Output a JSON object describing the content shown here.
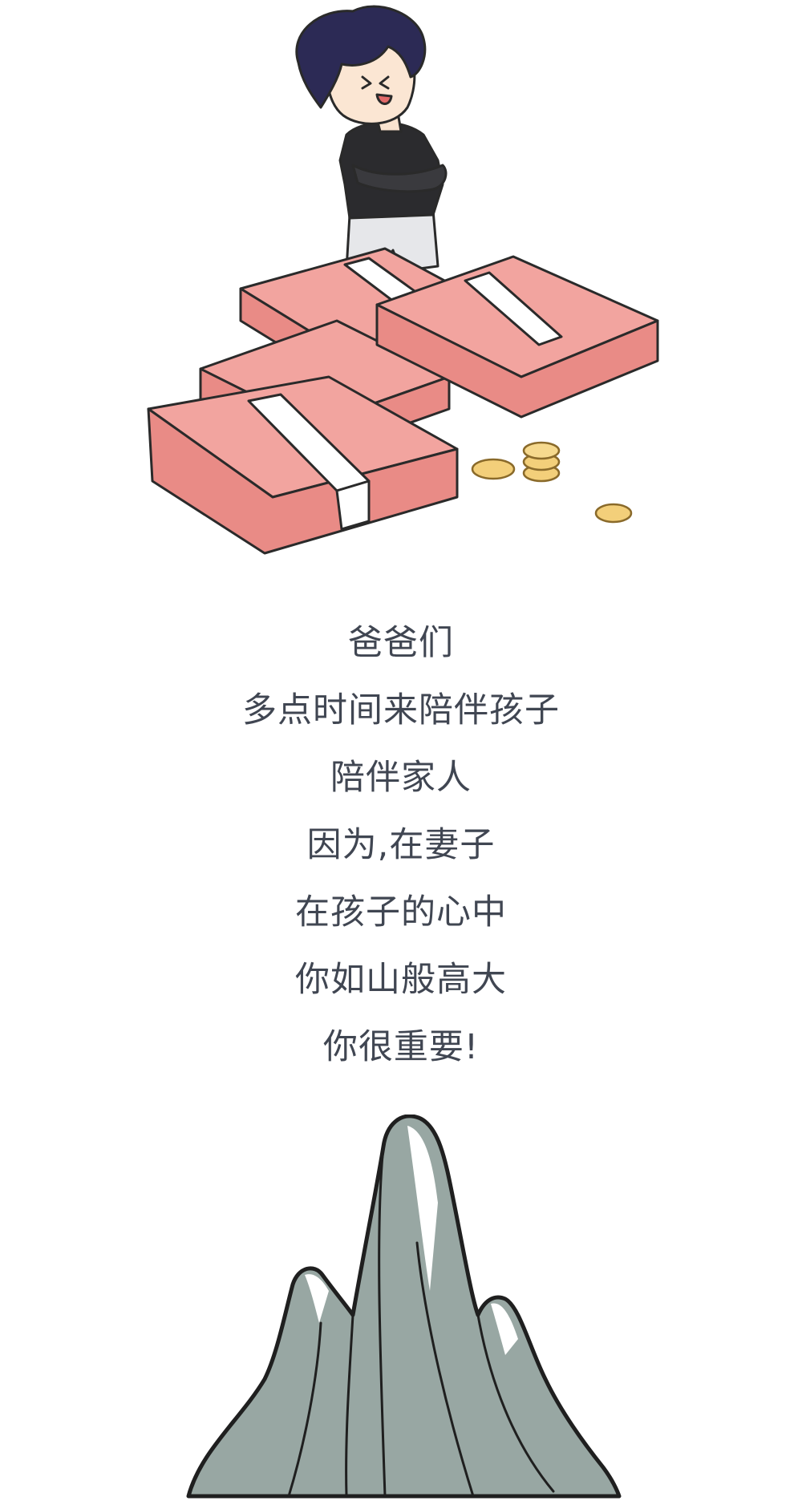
{
  "poem": {
    "lines": [
      "爸爸们",
      "多点时间来陪伴孩子",
      "陪伴家人",
      "因为,在妻子",
      "在孩子的心中",
      "你如山般高大",
      "你很重要!"
    ]
  },
  "colors": {
    "background": "#ffffff",
    "text": "#404652",
    "money": "#f2a49f",
    "money_band": "#ffffff",
    "coin": "#f3cf7a",
    "shirt": "#2b2b2e",
    "hair": "#2c2a55",
    "mountain": "#98a7a3",
    "outline": "#2a2a2a"
  },
  "illustrations": {
    "top": "boy-with-money-stacks",
    "bottom": "mountain"
  }
}
